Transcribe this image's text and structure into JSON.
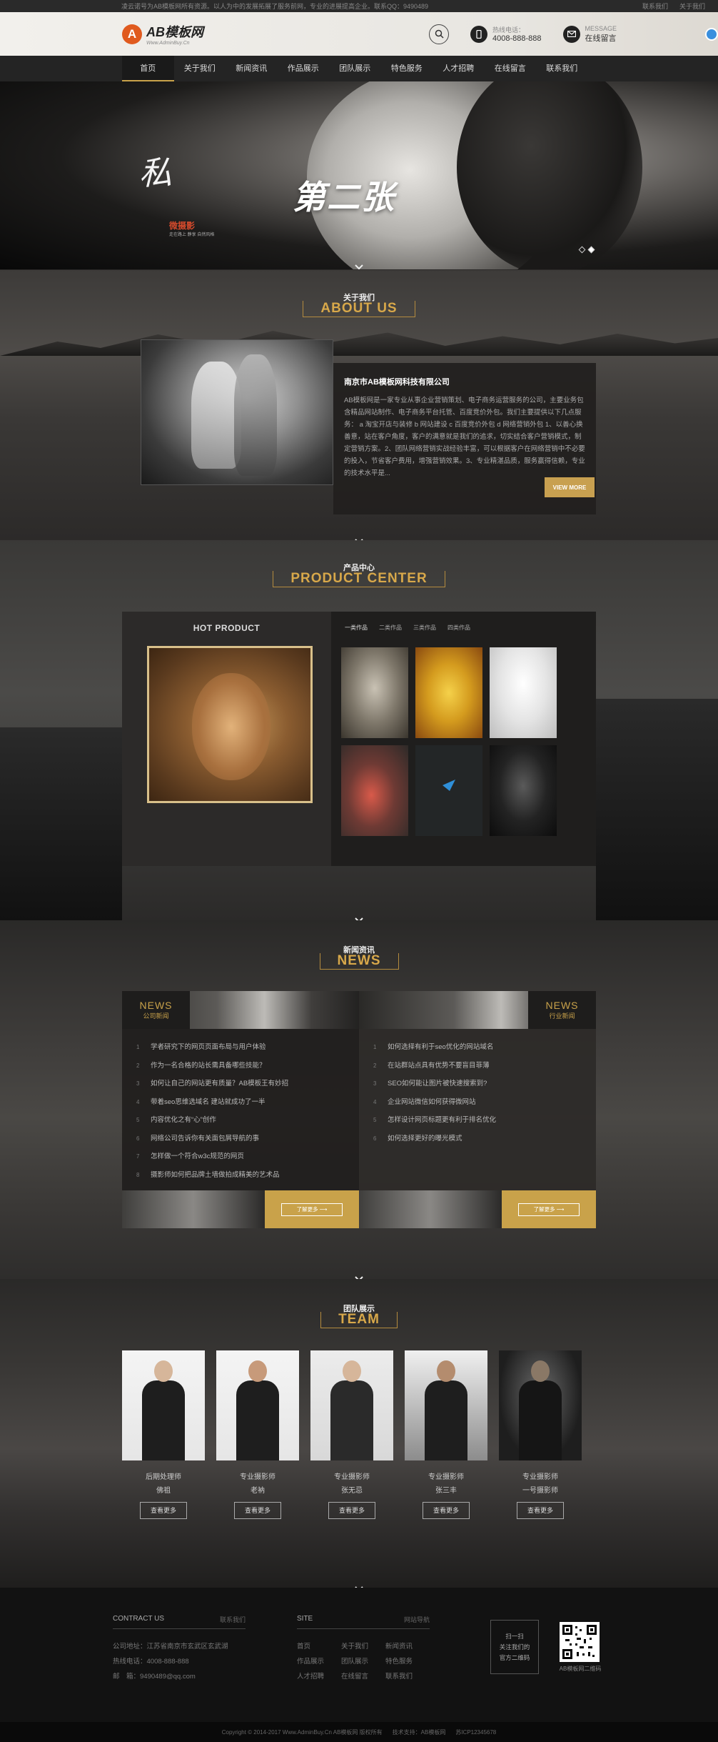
{
  "topbar": {
    "welcome": "凌云诺号为AB模板网所有资源。以人为中的发展拓展了服务前网，专业的进展提高企业。联系QQ：9490489",
    "links": [
      "联系我们",
      "关于我们"
    ]
  },
  "header": {
    "logo_main": "AB模板网",
    "logo_sub": "Www.AdminBuy.Cn",
    "phone_label": "热线电话：",
    "phone": "4008-888-888",
    "message_label": "MESSAGE",
    "message_text": "在线留言"
  },
  "nav": [
    "首页",
    "关于我们",
    "新闻资讯",
    "作品展示",
    "团队展示",
    "特色服务",
    "人才招聘",
    "在线留言",
    "联系我们"
  ],
  "banner": {
    "calligraphy": "私",
    "seal": "微摄影",
    "seal_sub": "走在路上 静享 自然风格",
    "headline": "第二张"
  },
  "about": {
    "title_cn": "关于我们",
    "title_en": "ABOUT US",
    "company": "南京市AB模板网科技有限公司",
    "body": "AB模板网是一家专业从事企业营销策划、电子商务运营服务的公司，主要业务包含精品网站制作、电子商务平台托管、百度竞价外包。我们主要提供以下几点服务： a 淘宝开店与装修 b 网站建设 c 百度竞价外包 d 网络营销外包 1、以善心换善意，站在客户角度，客户的满意就是我们的追求，切实结合客户营销模式，制定营销方案。2、团队网络营销实战经验丰富，可以根据客户在网络营销中不必要的投入，节省客户费用，增强营销效果。3、专业精湛品质，服务赢得信赖，专业的技术水平是...",
    "more": "VIEW MORE"
  },
  "product": {
    "title_cn": "产品中心",
    "title_en": "PRODUCT CENTER",
    "hot": "HOT PRODUCT",
    "tabs": [
      "一类作品",
      "二类作品",
      "三类作品",
      "四类作品"
    ]
  },
  "news": {
    "title_cn": "新闻资讯",
    "title_en": "NEWS",
    "left_en": "NEWS",
    "left_cn": "公司新闻",
    "right_en": "NEWS",
    "right_cn": "行业新闻",
    "left_items": [
      "学者研究下的网页页面布局与用户体验",
      "作为一名合格的站长需具备哪些技能？",
      "如何让自己的网站更有质量？AB模板王有妙招",
      "带着seo思维选域名 建站就成功了一半",
      "内容优化之有“心”创作",
      "网络公司告诉你有关面包屑导航的事",
      "怎样做一个符合w3c规范的网页",
      "摄影师如何把品牌土墙做拍成精美的艺术品"
    ],
    "right_items": [
      "如何选择有利于seo优化的网站域名",
      "在站群站点具有优势不要盲目菲薄",
      "SEO如何能让图片被快速搜索到?",
      "企业网站微信如何获得微网站",
      "怎样设计网页标题更有利于排名优化",
      "如何选择更好的曝光模式"
    ],
    "more": "了解更多"
  },
  "team": {
    "title_cn": "团队展示",
    "title_en": "TEAM",
    "members": [
      {
        "role": "后期处理师",
        "name": "佛祖"
      },
      {
        "role": "专业摄影师",
        "name": "老衲"
      },
      {
        "role": "专业摄影师",
        "name": "张无忌"
      },
      {
        "role": "专业摄影师",
        "name": "张三丰"
      },
      {
        "role": "专业摄影师",
        "name": "一号摄影师"
      }
    ],
    "more": "查看更多"
  },
  "footer": {
    "contact_head": "CONTRACT US",
    "contact_head_cn": "联系我们",
    "address": "公司地址：江苏省南京市玄武区玄武湖",
    "phone": "热线电话：4008-888-888",
    "email": "邮　箱：9490489@qq.com",
    "site_head": "SITE",
    "site_head_cn": "网站导航",
    "site_links": [
      "首页",
      "关于我们",
      "新闻资讯",
      "作品展示",
      "团队展示",
      "特色服务",
      "人才招聘",
      "在线留言",
      "联系我们"
    ],
    "qr_note_1": "扫一扫",
    "qr_note_2": "关注我们的",
    "qr_note_3": "官方二维码",
    "qr_caption": "AB模板网二维码",
    "copyright": "Copyright © 2014-2017 Www.AdminBuy.Cn AB模板网 版权所有",
    "tech": "技术支持：AB模板网",
    "icp": "苏ICP12345678"
  },
  "colors": {
    "accent": "#c9a24a",
    "logo": "#e05a1e"
  }
}
